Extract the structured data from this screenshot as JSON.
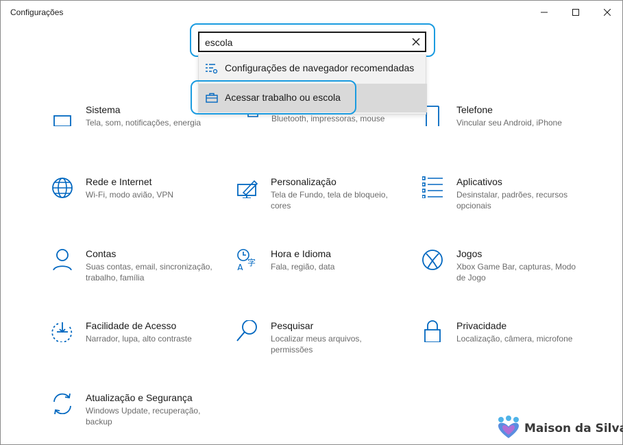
{
  "window": {
    "title": "Configurações"
  },
  "search": {
    "value": "escola",
    "placeholder": ""
  },
  "suggestions": [
    {
      "label": "Configurações de navegador recomendadas",
      "icon": "browser-settings-icon"
    },
    {
      "label": "Acessar trabalho ou escola",
      "icon": "briefcase-icon"
    }
  ],
  "categories": [
    {
      "title": "Sistema",
      "desc": "Tela, som, notificações, energia",
      "icon": "laptop-icon"
    },
    {
      "title": "Telefone",
      "desc": "Vincular seu Android, iPhone",
      "icon": "phone-icon"
    },
    {
      "title": "Rede e Internet",
      "desc": "Wi-Fi, modo avião, VPN",
      "icon": "globe-icon"
    },
    {
      "title": "Personalização",
      "desc": "Tela de Fundo, tela de bloqueio, cores",
      "icon": "paint-icon"
    },
    {
      "title": "Aplicativos",
      "desc": "Desinstalar, padrões, recursos opcionais",
      "icon": "apps-list-icon"
    },
    {
      "title": "Contas",
      "desc": "Suas contas, email, sincronização, trabalho, família",
      "icon": "person-icon"
    },
    {
      "title": "Hora e Idioma",
      "desc": "Fala, região, data",
      "icon": "time-language-icon"
    },
    {
      "title": "Jogos",
      "desc": "Xbox Game Bar, capturas, Modo de Jogo",
      "icon": "xbox-icon"
    },
    {
      "title": "Facilidade de Acesso",
      "desc": "Narrador, lupa, alto contraste",
      "icon": "ease-of-access-icon"
    },
    {
      "title": "Pesquisar",
      "desc": "Localizar meus arquivos, permissões",
      "icon": "search-icon"
    },
    {
      "title": "Privacidade",
      "desc": "Localização, câmera, microfone",
      "icon": "lock-icon"
    },
    {
      "title": "Atualização e Segurança",
      "desc": "Windows Update, recuperação, backup",
      "icon": "sync-icon"
    }
  ],
  "partially_hidden_desc": "Bluetooth, impressoras, mouse",
  "watermark": {
    "text": "Maison da Silva"
  },
  "colors": {
    "accent": "#0067c0",
    "focus_ring": "#1a9be0"
  }
}
